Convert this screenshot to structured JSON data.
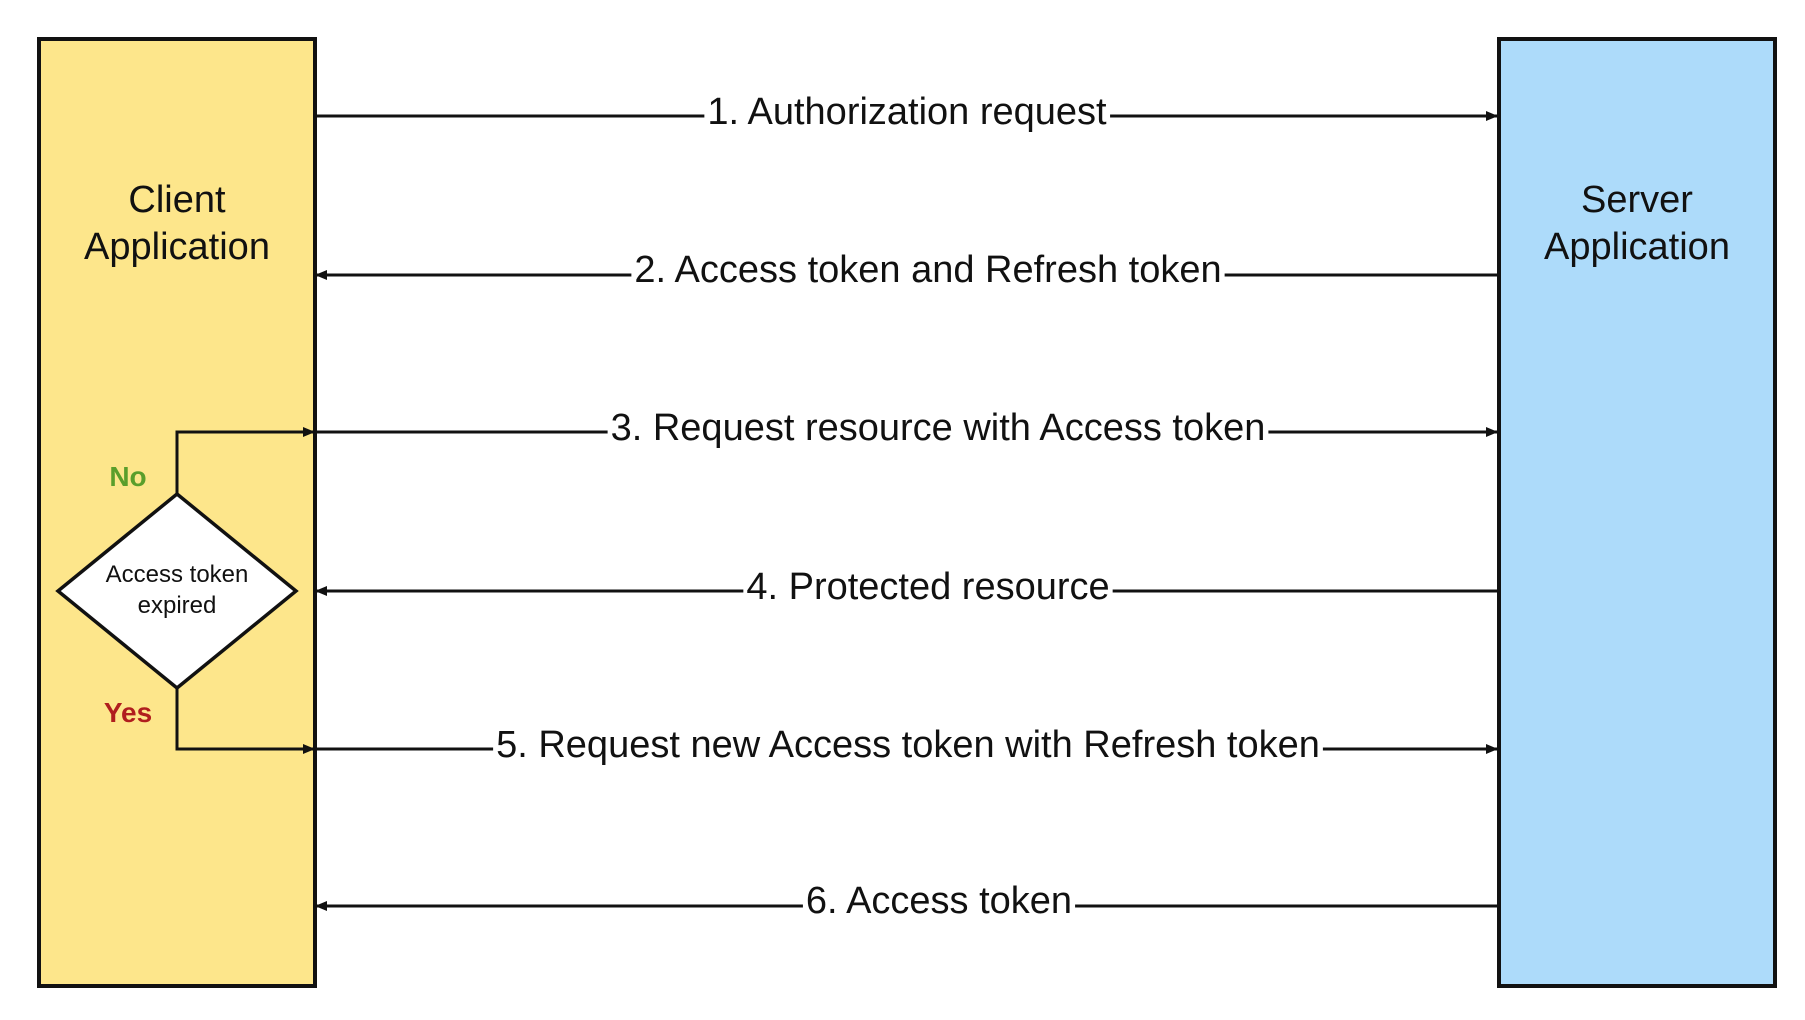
{
  "actors": {
    "client": {
      "label_line1": "Client",
      "label_line2": "Application",
      "fill": "#FDE68B"
    },
    "server": {
      "label_line1": "Server",
      "label_line2": "Application",
      "fill": "#ADDBFA"
    }
  },
  "decision": {
    "label_line1": "Access token",
    "label_line2": "expired",
    "no_label": "No",
    "yes_label": "Yes",
    "no_color": "#5A9E2B",
    "yes_color": "#B01E1E"
  },
  "messages": [
    {
      "label": "1. Authorization request",
      "direction": "to-server"
    },
    {
      "label": "2. Access token and Refresh token",
      "direction": "to-client"
    },
    {
      "label": "3. Request resource with Access token",
      "direction": "to-server"
    },
    {
      "label": "4. Protected resource",
      "direction": "to-client"
    },
    {
      "label": "5. Request new Access token with Refresh token",
      "direction": "to-server"
    },
    {
      "label": "6. Access token",
      "direction": "to-client"
    }
  ]
}
